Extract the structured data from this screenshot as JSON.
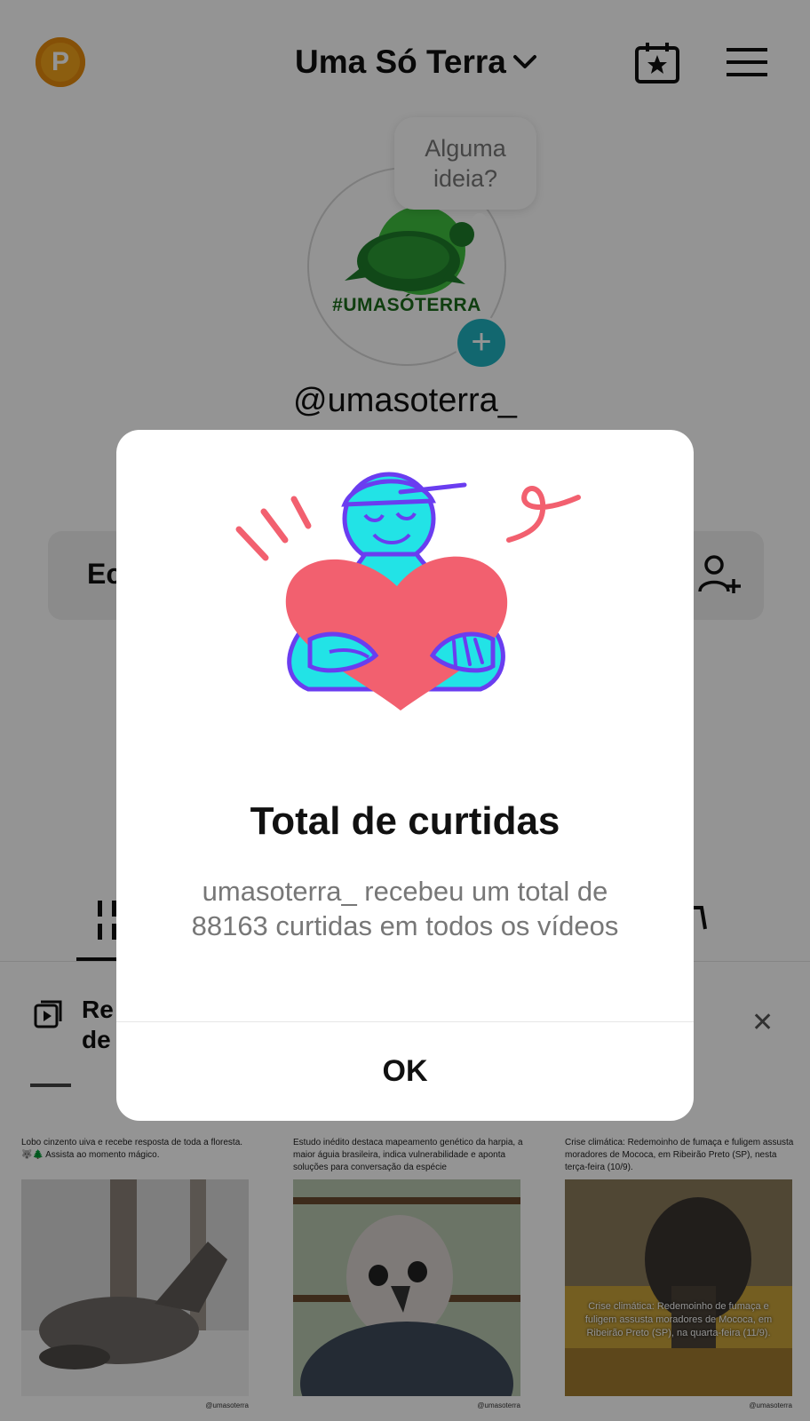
{
  "header": {
    "coin_letter": "P",
    "title": "Uma Só Terra"
  },
  "profile": {
    "bubble_text": "Alguma ideia?",
    "avatar_text": "#UMASÓTERRA",
    "username": "@umasoterra_",
    "edit_label": "Ec",
    "playlist_label": "Re\nde"
  },
  "videos": [
    {
      "caption": "Lobo cinzento uiva e recebe resposta de toda a floresta. 🐺🌲 Assista ao momento mágico.",
      "handle": "@umasoterra",
      "overlay": ""
    },
    {
      "caption": "Estudo inédito destaca mapeamento genético da harpia, a maior águia brasileira, indica vulnerabilidade e aponta soluções para conversação da espécie",
      "handle": "@umasoterra",
      "overlay": ""
    },
    {
      "caption": "Crise climática: Redemoinho de fumaça e fuligem assusta moradores de Mococa, em Ribeirão Preto (SP), nesta terça-feira (10/9).",
      "handle": "@umasoterra",
      "overlay": "Crise climática: Redemoinho de fumaça e fuligem assusta moradores de Mococa, em Ribeirão Preto (SP), na quarta-feira (11/9)."
    }
  ],
  "modal": {
    "title": "Total de curtidas",
    "message": "umasoterra_ recebeu um total de 88163 curtidas em todos os vídeos",
    "ok_label": "OK"
  },
  "colors": {
    "heart": "#f2606f",
    "figure": "#22e3e6",
    "outline": "#6a3df0",
    "accent_teal": "#20b2c0",
    "coin": "#f2a31b"
  }
}
